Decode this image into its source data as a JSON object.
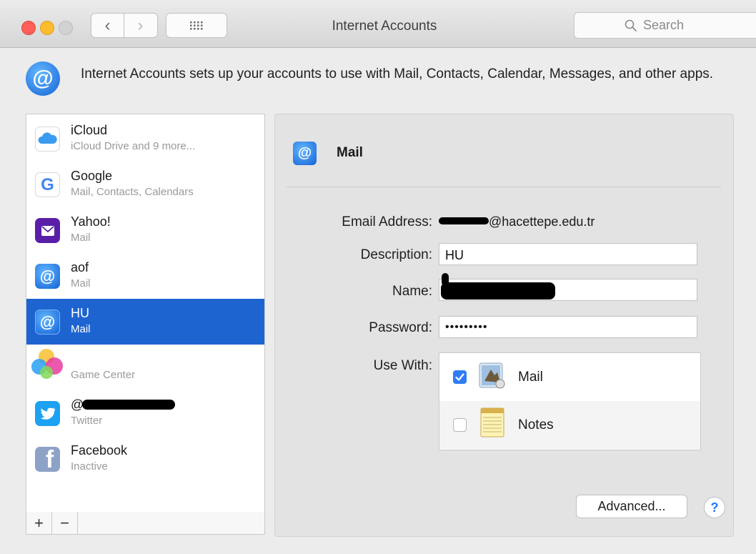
{
  "window": {
    "title": "Internet Accounts"
  },
  "toolbar": {
    "back_glyph": "‹",
    "forward_glyph": "›",
    "show_all_icon": "grid-icon"
  },
  "search": {
    "placeholder": "Search"
  },
  "header": {
    "text": "Internet Accounts sets up your accounts to use with Mail, Contacts, Calendar, Messages, and other apps."
  },
  "sidebar": {
    "accounts": [
      {
        "name": "iCloud",
        "sub": "iCloud Drive and 9 more...",
        "icon": "icloud-icon"
      },
      {
        "name": "Google",
        "sub": "Mail, Contacts, Calendars",
        "icon": "google-icon"
      },
      {
        "name": "Yahoo!",
        "sub": "Mail",
        "icon": "yahoo-mail-icon"
      },
      {
        "name": "aof",
        "sub": "Mail",
        "icon": "at-mail-icon"
      },
      {
        "name": "HU",
        "sub": "Mail",
        "icon": "at-mail-icon",
        "selected": true
      },
      {
        "name": "",
        "sub": "Game Center",
        "icon": "game-center-icon"
      },
      {
        "name": "@",
        "sub": "Twitter",
        "icon": "twitter-icon"
      },
      {
        "name": "Facebook",
        "sub": "Inactive",
        "icon": "facebook-icon"
      }
    ],
    "add_label": "+",
    "remove_label": "−"
  },
  "detail": {
    "title": "Mail",
    "email_label": "Email Address:",
    "email_value": "@hacettepe.edu.tr",
    "description_label": "Description:",
    "description_value": "HU",
    "name_label": "Name:",
    "name_value": "",
    "password_label": "Password:",
    "password_value": "•••••••••",
    "use_with_label": "Use With:",
    "use_with": [
      {
        "label": "Mail",
        "checked": true,
        "icon": "mail-app-icon"
      },
      {
        "label": "Notes",
        "checked": false,
        "icon": "notes-app-icon"
      }
    ],
    "advanced_label": "Advanced...",
    "help_label": "?"
  },
  "colors": {
    "selection": "#1e64d1",
    "accent": "#1e7bff"
  }
}
